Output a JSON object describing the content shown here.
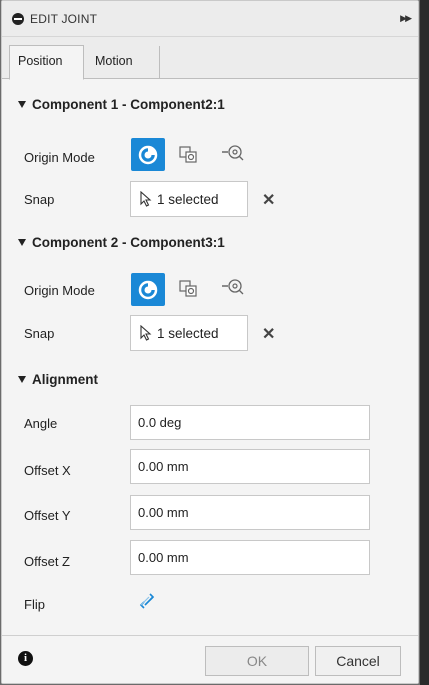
{
  "window": {
    "title": "EDIT JOINT"
  },
  "tabs": [
    {
      "label": "Position",
      "active": true
    },
    {
      "label": "Motion",
      "active": false
    }
  ],
  "component1": {
    "header": "Component 1 - Component2:1",
    "origin_mode_label": "Origin Mode",
    "snap_label": "Snap",
    "snap_value": "1 selected"
  },
  "component2": {
    "header": "Component 2 - Component3:1",
    "origin_mode_label": "Origin Mode",
    "snap_label": "Snap",
    "snap_value": "1 selected"
  },
  "alignment": {
    "header": "Alignment",
    "angle_label": "Angle",
    "angle_value": "0.0 deg",
    "offset_x_label": "Offset X",
    "offset_x_value": "0.00 mm",
    "offset_y_label": "Offset Y",
    "offset_y_value": "0.00 mm",
    "offset_z_label": "Offset Z",
    "offset_z_value": "0.00 mm",
    "flip_label": "Flip"
  },
  "footer": {
    "ok_label": "OK",
    "cancel_label": "Cancel"
  },
  "colors": {
    "accent": "#1a88d6"
  }
}
